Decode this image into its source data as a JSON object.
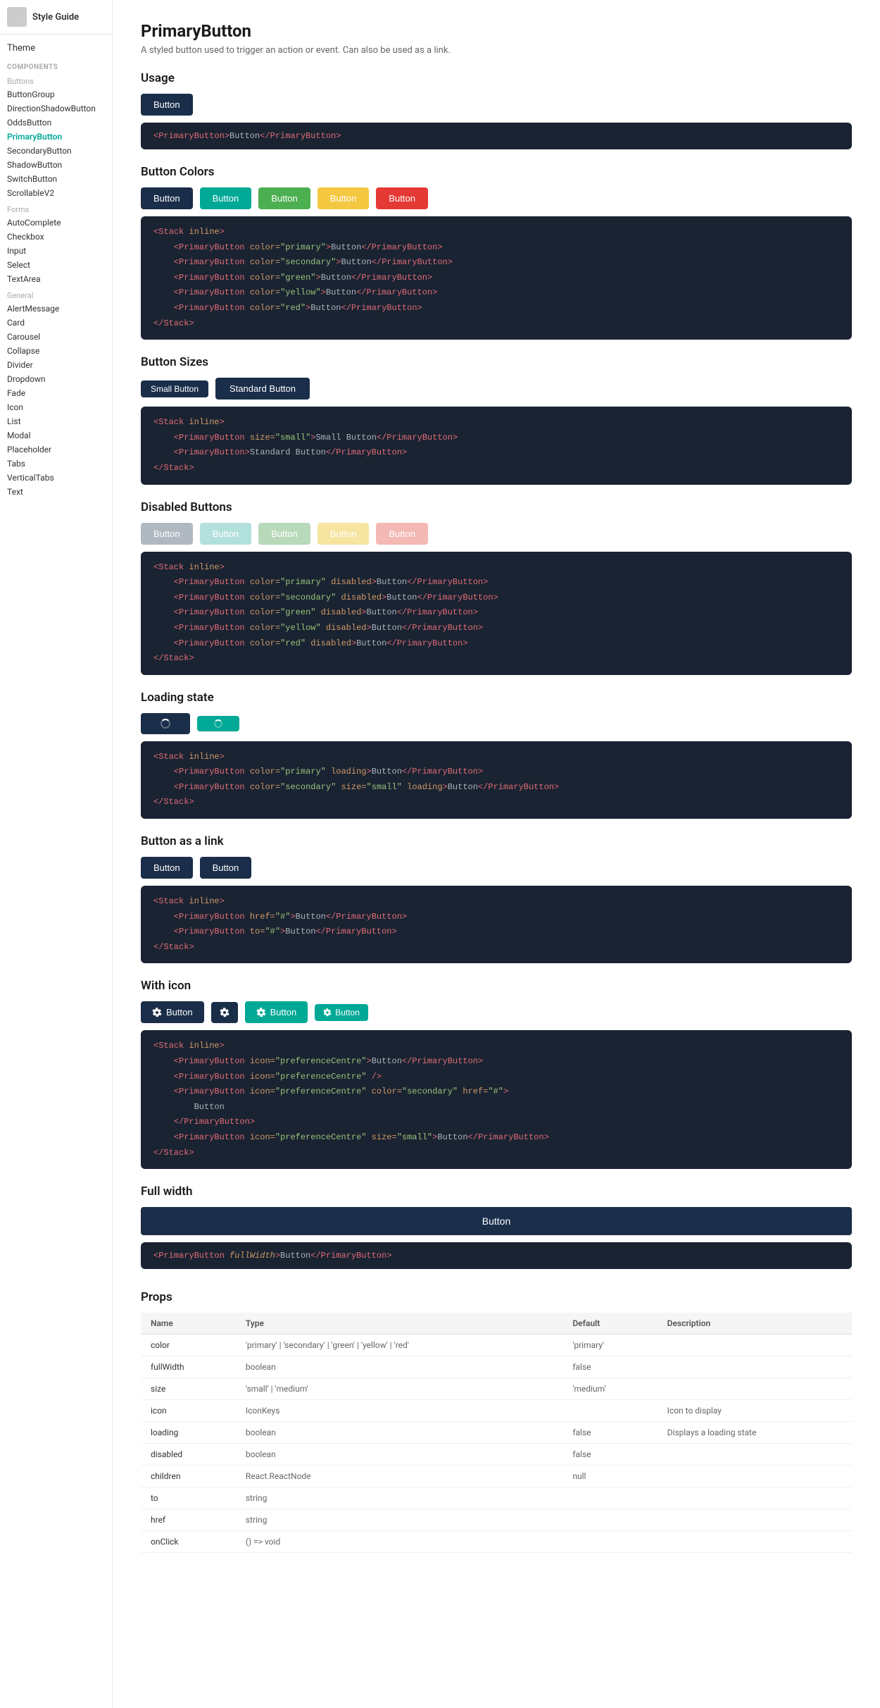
{
  "sidebar": {
    "logo_alt": "logo",
    "title": "Style Guide",
    "theme_label": "Theme",
    "components_label": "COMPONENTS",
    "buttons_group": "Buttons",
    "items_buttons": [
      {
        "label": "ButtonGroup",
        "active": false
      },
      {
        "label": "DirectionShadowButton",
        "active": false
      },
      {
        "label": "OddsButton",
        "active": false
      },
      {
        "label": "PrimaryButton",
        "active": true
      },
      {
        "label": "SecondaryButton",
        "active": false
      },
      {
        "label": "ShadowButton",
        "active": false
      },
      {
        "label": "SwitchButton",
        "active": false
      },
      {
        "label": "ScrollableV2",
        "active": false
      }
    ],
    "forms_group": "Forms",
    "items_forms": [
      {
        "label": "AutoComplete",
        "active": false
      },
      {
        "label": "Checkbox",
        "active": false
      },
      {
        "label": "Input",
        "active": false
      },
      {
        "label": "Select",
        "active": false
      },
      {
        "label": "TextArea",
        "active": false
      }
    ],
    "general_group": "General",
    "items_general": [
      {
        "label": "AlertMessage",
        "active": false
      },
      {
        "label": "Card",
        "active": false
      },
      {
        "label": "Carousel",
        "active": false
      },
      {
        "label": "Collapse",
        "active": false
      },
      {
        "label": "Divider",
        "active": false
      },
      {
        "label": "Dropdown",
        "active": false
      },
      {
        "label": "Fade",
        "active": false
      },
      {
        "label": "Icon",
        "active": false
      },
      {
        "label": "List",
        "active": false
      },
      {
        "label": "Modal",
        "active": false
      },
      {
        "label": "Placeholder",
        "active": false
      },
      {
        "label": "Tabs",
        "active": false
      },
      {
        "label": "VerticalTabs",
        "active": false
      },
      {
        "label": "Text",
        "active": false
      }
    ]
  },
  "main": {
    "page_title": "PrimaryButton",
    "page_subtitle": "A styled button used to trigger an action or event. Can also be used as a link.",
    "sections": {
      "usage": {
        "title": "Usage",
        "button_label": "Button",
        "code": "<PrimaryButton>Button</PrimaryButton>"
      },
      "button_colors": {
        "title": "Button Colors",
        "buttons": [
          "Button",
          "Button",
          "Button",
          "Button",
          "Button"
        ],
        "code_lines": [
          "<Stack inline>",
          "    <PrimaryButton color=\"primary\">Button</PrimaryButton>",
          "    <PrimaryButton color=\"secondary\">Button</PrimaryButton>",
          "    <PrimaryButton color=\"green\">Button</PrimaryButton>",
          "    <PrimaryButton color=\"yellow\">Button</PrimaryButton>",
          "    <PrimaryButton color=\"red\">Button</PrimaryButton>",
          "</Stack>"
        ]
      },
      "button_sizes": {
        "title": "Button Sizes",
        "small_label": "Small Button",
        "standard_label": "Standard Button",
        "code_lines": [
          "<Stack inline>",
          "    <PrimaryButton size=\"small\">Small Button</PrimaryButton>",
          "    <PrimaryButton>Standard Button</PrimaryButton>",
          "</Stack>"
        ]
      },
      "disabled_buttons": {
        "title": "Disabled Buttons",
        "buttons": [
          "Button",
          "Button",
          "Button",
          "Button",
          "Button"
        ],
        "code_lines": [
          "<Stack inline>",
          "    <PrimaryButton color=\"primary\" disabled>Button</PrimaryButton>",
          "    <PrimaryButton color=\"secondary\" disabled>Button</PrimaryButton>",
          "    <PrimaryButton color=\"green\" disabled>Button</PrimaryButton>",
          "    <PrimaryButton color=\"yellow\" disabled>Button</PrimaryButton>",
          "    <PrimaryButton color=\"red\" disabled>Button</PrimaryButton>",
          "</Stack>"
        ]
      },
      "loading_state": {
        "title": "Loading state",
        "code_lines": [
          "<Stack inline>",
          "    <PrimaryButton color=\"primary\" loading>Button</PrimaryButton>",
          "    <PrimaryButton color=\"secondary\" size=\"small\" loading>Button</PrimaryButton>",
          "</Stack>"
        ]
      },
      "button_as_link": {
        "title": "Button as a link",
        "buttons": [
          "Button",
          "Button"
        ],
        "code_lines": [
          "<Stack inline>",
          "    <PrimaryButton href=\"#\">Button</PrimaryButton>",
          "    <PrimaryButton to=\"#\">Button</PrimaryButton>",
          "</Stack>"
        ]
      },
      "with_icon": {
        "title": "With icon",
        "buttons": [
          "Button",
          "",
          "Button",
          "Button"
        ],
        "code_lines": [
          "<Stack inline>",
          "    <PrimaryButton icon=\"preferenceCentre\">Button</PrimaryButton>",
          "    <PrimaryButton icon=\"preferenceCentre\" />",
          "    <PrimaryButton icon=\"preferenceCentre\" color=\"secondary\" href=\"#\">",
          "        Button",
          "    </PrimaryButton>",
          "    <PrimaryButton icon=\"preferenceCentre\" size=\"small\">Button</PrimaryButton>",
          "</Stack>"
        ]
      },
      "full_width": {
        "title": "Full width",
        "button_label": "Button",
        "code": "<PrimaryButton fullWidth>Button</PrimaryButton>"
      }
    },
    "props": {
      "title": "Props",
      "headers": [
        "Name",
        "Type",
        "Default",
        "Description"
      ],
      "rows": [
        {
          "name": "color",
          "type": "'primary' | 'secondary' | 'green' | 'yellow' | 'red'",
          "default": "'primary'",
          "description": ""
        },
        {
          "name": "fullWidth",
          "type": "boolean",
          "default": "false",
          "description": ""
        },
        {
          "name": "size",
          "type": "'small' | 'medium'",
          "default": "'medium'",
          "description": ""
        },
        {
          "name": "icon",
          "type": "IconKeys",
          "default": "",
          "description": "Icon to display"
        },
        {
          "name": "loading",
          "type": "boolean",
          "default": "false",
          "description": "Displays a loading state"
        },
        {
          "name": "disabled",
          "type": "boolean",
          "default": "false",
          "description": ""
        },
        {
          "name": "children",
          "type": "React.ReactNode",
          "default": "null",
          "description": ""
        },
        {
          "name": "to",
          "type": "string",
          "default": "",
          "description": ""
        },
        {
          "name": "href",
          "type": "string",
          "default": "",
          "description": ""
        },
        {
          "name": "onClick",
          "type": "() => void",
          "default": "",
          "description": ""
        }
      ]
    }
  }
}
